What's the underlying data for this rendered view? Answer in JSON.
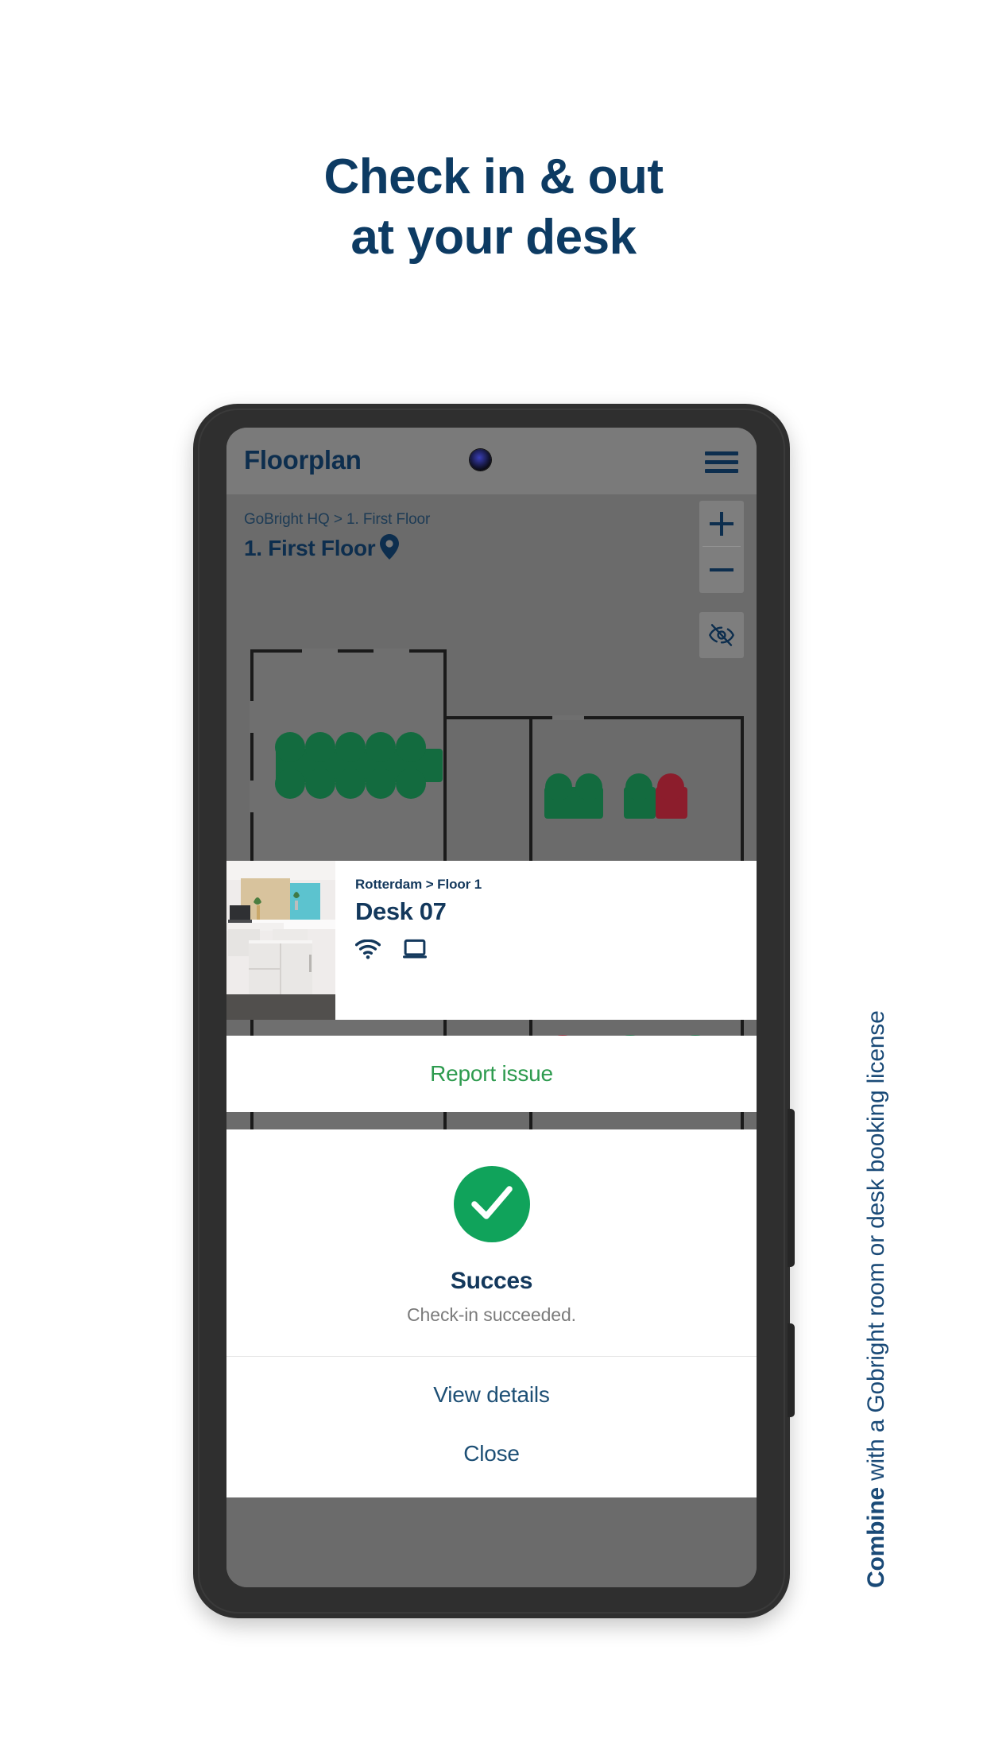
{
  "headline": {
    "line1": "Check in & out",
    "line2": "at your desk",
    "color": "#0d3b63"
  },
  "caption": {
    "bold_prefix": "Combine",
    "rest": " with a Gobright room or desk booking license"
  },
  "app": {
    "appbar": {
      "title": "Floorplan",
      "menu_icon": "hamburger-menu-icon",
      "camera_icon": "front-camera-icon"
    },
    "breadcrumb": "GoBright HQ > 1. First Floor",
    "floor_title": "1. First Floor",
    "pin_icon": "location-pin-icon",
    "map_controls": [
      {
        "name": "zoom-in-button",
        "label": "+"
      },
      {
        "name": "zoom-out-button",
        "label": "−"
      },
      {
        "name": "hide-labels-button",
        "label": "eye-off-icon"
      }
    ]
  },
  "desk_card": {
    "breadcrumb": "Rotterdam > Floor 1",
    "name": "Desk 07",
    "photo_alt": "desk-photo",
    "amenities": [
      {
        "name": "wifi-icon",
        "label": "Wi-Fi"
      },
      {
        "name": "monitor-icon",
        "label": "Monitor"
      }
    ]
  },
  "report": {
    "label": "Report issue",
    "color": "#2e9b4f"
  },
  "dialog": {
    "status_icon": "success-check-icon",
    "status_color": "#10a35b",
    "title": "Succes",
    "message": "Check-in succeeded.",
    "primary_action": "View details"
  },
  "close_button": {
    "label": "Close"
  },
  "floorplan_markers": {
    "available_color": "#136b3f",
    "occupied_color": "#8c1d2c"
  }
}
